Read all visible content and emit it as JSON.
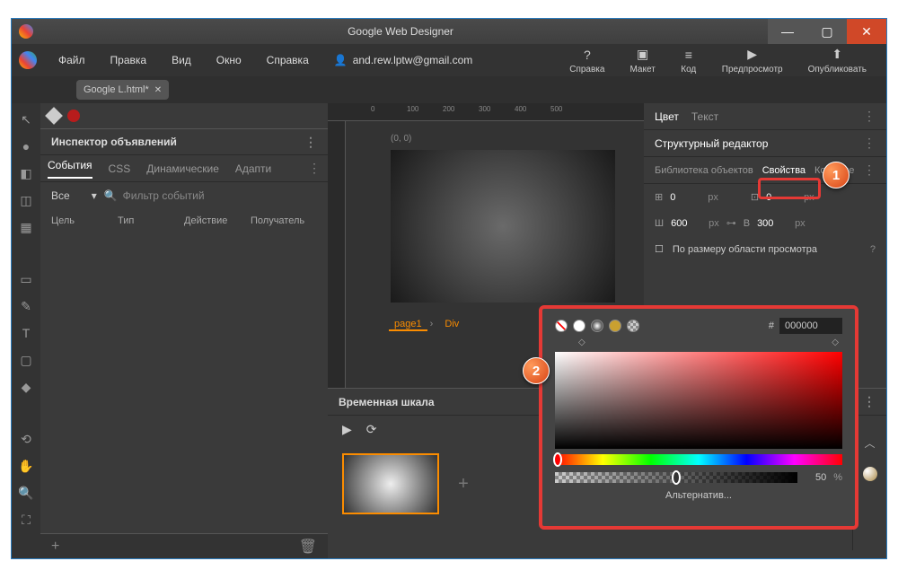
{
  "window": {
    "title": "Google Web Designer"
  },
  "menus": {
    "file": "Файл",
    "edit": "Правка",
    "view": "Вид",
    "window": "Окно",
    "help": "Справка"
  },
  "user": {
    "email": "and.rew.lptw@gmail.com"
  },
  "toolbar_right": {
    "help": "Справка",
    "layout": "Макет",
    "code": "Код",
    "preview": "Предпросмотр",
    "publish": "Опубликовать"
  },
  "tab": {
    "name": "Google L.html*"
  },
  "inspector": {
    "title": "Инспектор объявлений",
    "tabs": {
      "events": "События",
      "css": "CSS",
      "dynamic": "Динамические",
      "adaptive": "Адапти"
    },
    "filter_all": "Все",
    "filter_placeholder": "Фильтр событий",
    "cols": {
      "target": "Цель",
      "type": "Тип",
      "action": "Действие",
      "receiver": "Получатель"
    }
  },
  "canvas": {
    "coord": "(0, 0)",
    "page": "page1",
    "elem": "Div"
  },
  "timeline": {
    "title": "Временная шкала"
  },
  "right": {
    "color": "Цвет",
    "text": "Текст",
    "structure": "Структурный редактор",
    "library": "Библиотека объектов",
    "properties": "Свойства",
    "components": "Компоне",
    "top_label": "0",
    "left_label": "0",
    "w_label": "Ш",
    "w_val": "600",
    "h_label": "В",
    "h_val": "300",
    "unit": "px",
    "viewport": "По размеру области просмотра"
  },
  "picker": {
    "hex_prefix": "#",
    "hex": "000000",
    "alpha": "50",
    "pct": "%",
    "alt": "Альтернатив..."
  },
  "badges": {
    "one": "1",
    "two": "2"
  }
}
